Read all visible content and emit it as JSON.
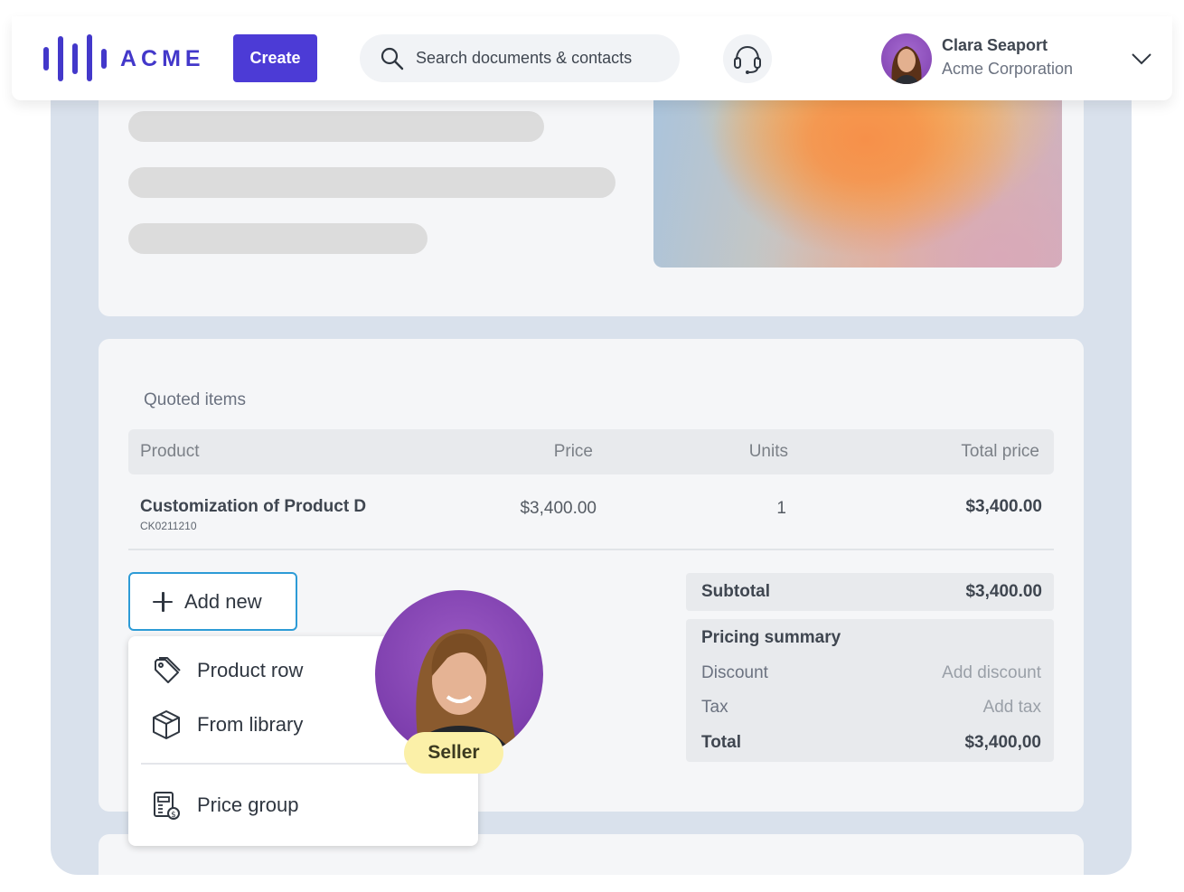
{
  "header": {
    "logo_text": "ACME",
    "create_label": "Create",
    "search_placeholder": "Search documents & contacts",
    "user": {
      "name": "Clara Seaport",
      "organization": "Acme Corporation"
    }
  },
  "quote": {
    "section_title": "Quoted items",
    "columns": {
      "product": "Product",
      "price": "Price",
      "units": "Units",
      "total": "Total price"
    },
    "rows": [
      {
        "name": "Customization of Product D",
        "sku": "CK0211210",
        "price": "$3,400.00",
        "units": "1",
        "total": "$3,400.00"
      }
    ]
  },
  "add_menu": {
    "button_label": "Add new",
    "items": [
      {
        "label": "Product row",
        "icon": "tag-icon"
      },
      {
        "label": "From library",
        "icon": "cube-icon"
      },
      {
        "label": "Price group",
        "icon": "price-group-icon"
      }
    ]
  },
  "seller": {
    "badge": "Seller"
  },
  "summary": {
    "subtotal_label": "Subtotal",
    "subtotal_value": "$3,400.00",
    "pricing_title": "Pricing summary",
    "discount_label": "Discount",
    "discount_action": "Add discount",
    "tax_label": "Tax",
    "tax_action": "Add tax",
    "total_label": "Total",
    "total_value": "$3,400,00"
  },
  "colors": {
    "brand": "#4c3bd6",
    "add_border": "#2d9bd6",
    "seller_badge": "#fbf0a8"
  }
}
